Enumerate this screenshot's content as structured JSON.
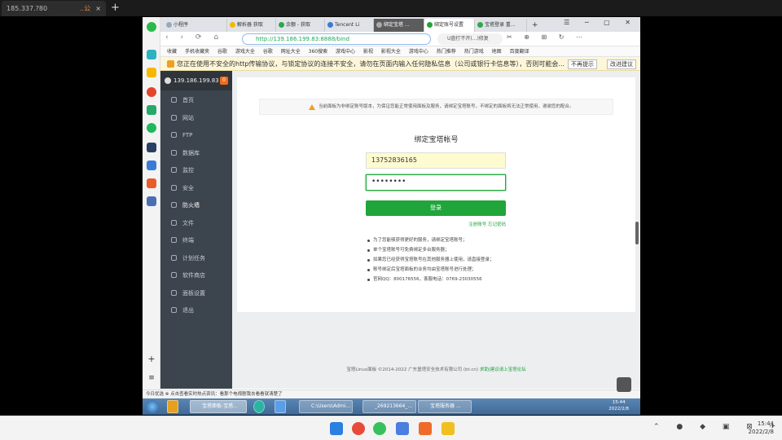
{
  "outer": {
    "tab_title": "185.337.?80",
    "tab_extra": "..公",
    "close": "×",
    "new_tab": "+"
  },
  "browser": {
    "tabs": [
      "小程序",
      "解析器 获取",
      "余额 - 获取",
      "Tencent Li",
      "绑定宝塔 ...",
      "绑定账号设置",
      "宝塔登录 重...",
      "+"
    ],
    "window_controls": "☰ ─ ▢ ✕",
    "nav": "‹ › ⟳ ⌂",
    "url": "http://139.186.199.83:8888/bind",
    "search": "U盘打不开(...)修复",
    "tools": "✂ ⊕ ⊞ ↻ ⋯",
    "bookmarks": [
      "收藏",
      "手机收藏夹",
      "谷歌",
      "游戏大全",
      "谷歌",
      "网址大全",
      "360搜索",
      "游戏中心",
      "影视",
      "影视大全",
      "游戏中心",
      "热门推荐",
      "热门游戏",
      "地图",
      "百度翻译"
    ],
    "warning": "您正在使用不安全的http传输协议，与锁定协议的连接不安全，请勿在页面内输入任何隐私信息（公司或银行卡信息等），否则可能会...",
    "warning_btn1": "不再提示",
    "warning_btn2": "改进建议"
  },
  "panel": {
    "ip": "139.186.199.83",
    "badge": "0",
    "menu": [
      "首页",
      "网站",
      "FTP",
      "数据库",
      "监控",
      "安全",
      "防火墙",
      "文件",
      "终端",
      "计划任务",
      "软件商店",
      "面板设置",
      "退出"
    ]
  },
  "bind": {
    "notice": "当前面板为非绑定账号版本，为保证您能正常使用面板及服务，请绑定宝塔账号，不绑定的面板将无法正常使用，谢谢您的配合。",
    "title": "绑定宝塔帐号",
    "phone_value": "13752836165",
    "password_value": "••••••••",
    "login_label": "登录",
    "links": "注册账号  忘记密码",
    "tips": [
      "为了您能够获得更好的服务，请绑定宝塔账号；",
      "单个宝塔账号可免费绑定多台服务器；",
      "如果您已经获得宝塔账号在其他服务器上使用，请直接登录；",
      "账号绑定后宝塔面板的业务均由宝塔账号进行处理；",
      "官网QQ：800176556，客服电话：0769-23030556"
    ],
    "footer": "宝塔Linux面板 ©2014-2022 广东堡塔安全技术有限公司 (bt.cn)",
    "footer_link": "求助|建议请上宝塔论坛"
  },
  "statusbar": "今日优选  ⊗ 点击查看实时热点资讯：看那个电视剧我去看看就清楚了",
  "win7": {
    "tasks": [
      "宝塔面板-宝塔...",
      "C:\\Users\\Admi...",
      "_269213664_...",
      "宝塔服务器 ..."
    ],
    "clock_time": "15:44",
    "clock_date": "2022/2/8"
  },
  "taskbar": {
    "time": "15:44",
    "date": "2022/2/8"
  }
}
